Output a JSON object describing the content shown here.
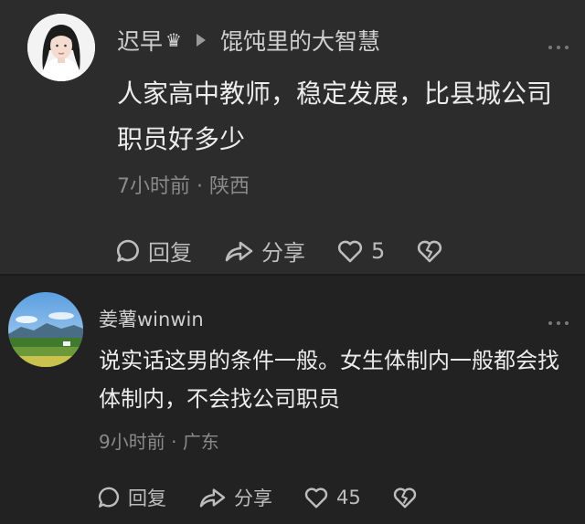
{
  "comments": [
    {
      "username": "迟早",
      "crown": "♛",
      "reply_to": "馄饨里的大智慧",
      "text": "人家高中教师，稳定发展，比县城公司职员好多少",
      "time": "7小时前",
      "location": "陕西",
      "reply_label": "回复",
      "share_label": "分享",
      "likes": "5"
    },
    {
      "username": "姜薯winwin",
      "text": "说实话这男的条件一般。女生体制内一般都会找体制内，不会找公司职员",
      "time": "9小时前",
      "location": "广东",
      "reply_label": "回复",
      "share_label": "分享",
      "likes": "45"
    }
  ],
  "separator": " · ",
  "colors": {
    "background": "#2c2c2c",
    "text": "#ececec",
    "muted": "#8a8a8a"
  }
}
